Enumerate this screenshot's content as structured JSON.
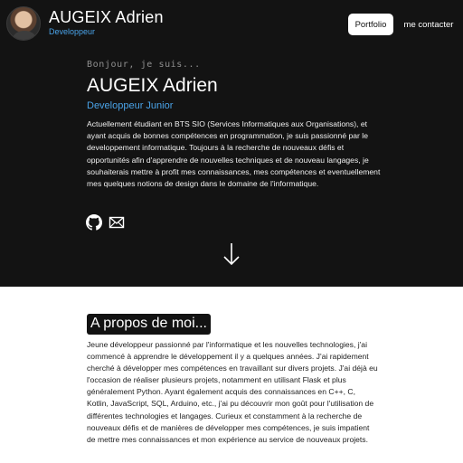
{
  "header": {
    "name": "AUGEIX Adrien",
    "role": "Developpeur",
    "nav": {
      "portfolio": "Portfolio",
      "contact": "me contacter"
    }
  },
  "hero": {
    "greeting": "Bonjour, je suis...",
    "name": "AUGEIX Adrien",
    "role": "Developpeur Junior",
    "description": "Actuellement étudiant en BTS SIO (Services Informatiques aux Organisations), et ayant acquis de bonnes compétences en programmation, je suis passionné par le developpement informatique. Toujours à la recherche de nouveaux défis et opportunités afin d'apprendre de nouvelles techniques et de nouveau langages, je souhaiterais mettre à profit mes connaissances, mes compétences et eventuellement mes quelques notions de design dans le domaine de l'informatique.",
    "icons": [
      "github-icon",
      "mail-icon",
      "arrow-down-icon"
    ]
  },
  "about": {
    "title": "A propos de moi...",
    "text": "Jeune développeur passionné par l'informatique et les nouvelles technologies, j'ai commencé à apprendre le développement il y a quelques années. J'ai rapidement cherché à développer mes compétences en travaillant sur divers projets. J'ai déjà eu l'occasion de réaliser plusieurs projets, notamment en utilisant Flask et plus généralement Python. Ayant également acquis des connaissances en C++, C, Kotlin, JavaScript, SQL, Arduino, etc., j'ai pu découvrir mon goût pour l'utilisation de différentes technologies et langages. Curieux et constamment à la recherche de nouveaux défis et de manières de développer mes compétences, je suis impatient de mettre mes connaissances et mon expérience au service de nouveaux projets."
  },
  "colors": {
    "dark_bg": "#131313",
    "accent": "#4aa3e8",
    "light_bg": "#ffffff"
  }
}
